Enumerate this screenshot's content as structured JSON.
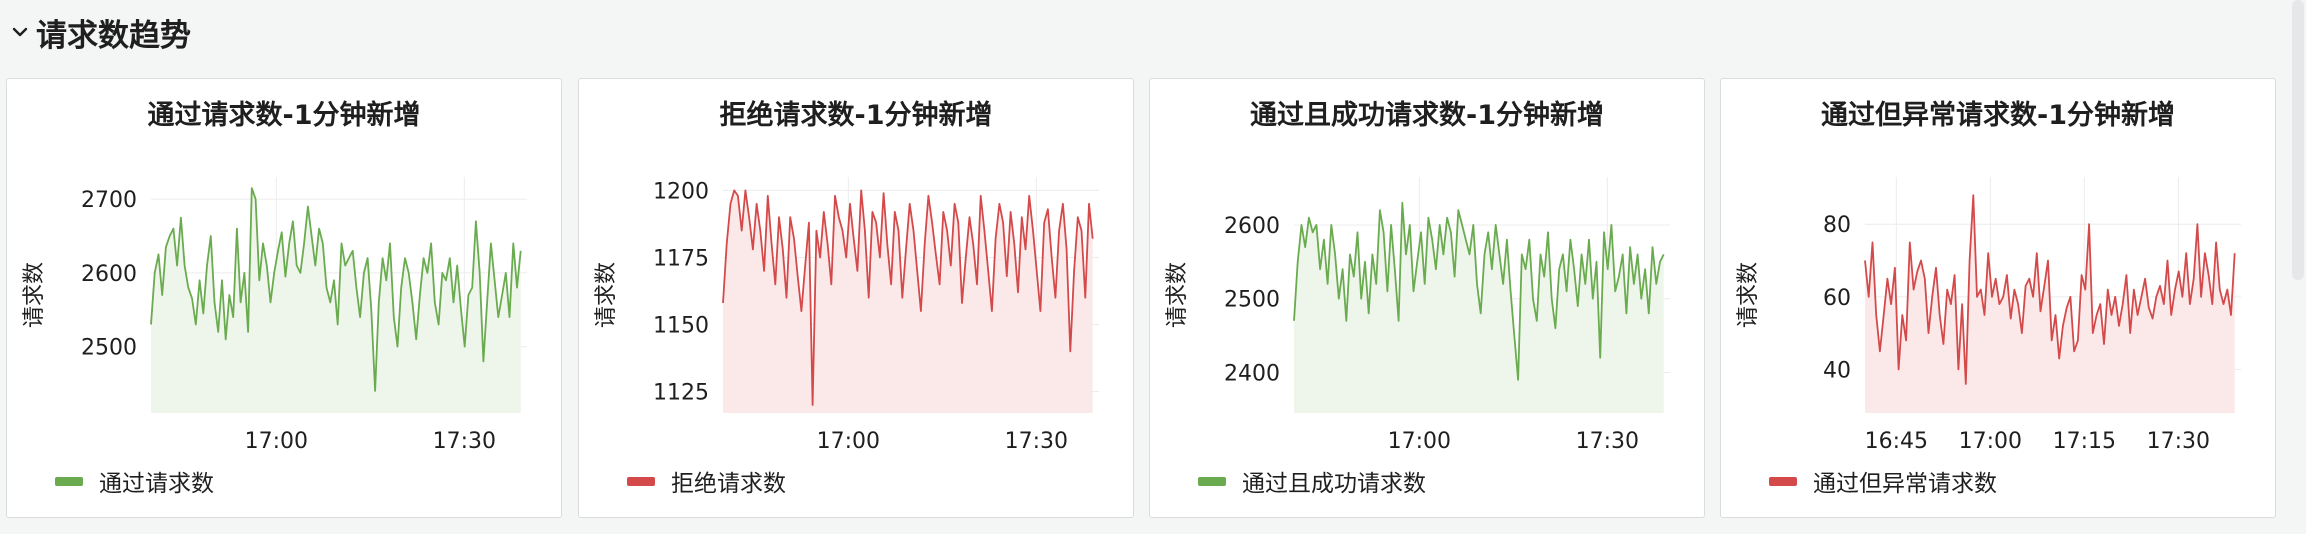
{
  "section": {
    "title": "请求数趋势"
  },
  "chart_data": [
    {
      "type": "area",
      "title": "通过请求数-1分钟新增",
      "ylabel": "请求数",
      "yticks": [
        2500,
        2600,
        2700
      ],
      "ylim": [
        2410,
        2730
      ],
      "xticks": [
        "17:00",
        "17:30"
      ],
      "xlim": [
        "16:40",
        "17:40"
      ],
      "color": "#6aab50",
      "fill": "#eef5ea",
      "series": [
        {
          "name": "通过请求数",
          "x_start": "16:40",
          "x_end": "17:39",
          "values": [
            2530,
            2600,
            2625,
            2570,
            2635,
            2650,
            2660,
            2610,
            2675,
            2610,
            2580,
            2565,
            2530,
            2590,
            2545,
            2610,
            2650,
            2560,
            2520,
            2590,
            2510,
            2570,
            2540,
            2660,
            2560,
            2600,
            2520,
            2715,
            2700,
            2590,
            2640,
            2610,
            2560,
            2600,
            2630,
            2655,
            2595,
            2640,
            2670,
            2610,
            2600,
            2640,
            2690,
            2650,
            2610,
            2660,
            2640,
            2580,
            2560,
            2590,
            2530,
            2640,
            2610,
            2620,
            2630,
            2580,
            2540,
            2600,
            2620,
            2550,
            2440,
            2560,
            2620,
            2590,
            2640,
            2540,
            2500,
            2580,
            2620,
            2600,
            2560,
            2510,
            2570,
            2620,
            2600,
            2640,
            2560,
            2530,
            2600,
            2590,
            2620,
            2560,
            2610,
            2550,
            2500,
            2570,
            2580,
            2670,
            2600,
            2480,
            2560,
            2640,
            2590,
            2540,
            2570,
            2600,
            2540,
            2640,
            2580,
            2630
          ]
        }
      ]
    },
    {
      "type": "area",
      "title": "拒绝请求数-1分钟新增",
      "ylabel": "请求数",
      "yticks": [
        1125,
        1150,
        1175,
        1200
      ],
      "ylim": [
        1117,
        1205
      ],
      "xticks": [
        "17:00",
        "17:30"
      ],
      "xlim": [
        "16:40",
        "17:40"
      ],
      "color": "#d44a4a",
      "fill": "#fbe9ea",
      "series": [
        {
          "name": "拒绝请求数",
          "x_start": "16:40",
          "x_end": "17:39",
          "values": [
            1158,
            1180,
            1195,
            1200,
            1198,
            1185,
            1200,
            1190,
            1178,
            1195,
            1185,
            1170,
            1198,
            1180,
            1165,
            1190,
            1178,
            1160,
            1190,
            1182,
            1168,
            1155,
            1172,
            1188,
            1120,
            1185,
            1175,
            1192,
            1180,
            1165,
            1198,
            1190,
            1185,
            1175,
            1195,
            1182,
            1170,
            1200,
            1185,
            1160,
            1192,
            1188,
            1175,
            1199,
            1180,
            1165,
            1192,
            1185,
            1160,
            1178,
            1195,
            1185,
            1170,
            1155,
            1180,
            1198,
            1188,
            1176,
            1165,
            1192,
            1185,
            1172,
            1195,
            1188,
            1158,
            1175,
            1190,
            1180,
            1165,
            1198,
            1185,
            1170,
            1155,
            1182,
            1195,
            1188,
            1168,
            1192,
            1180,
            1162,
            1190,
            1178,
            1198,
            1185,
            1170,
            1155,
            1188,
            1193,
            1175,
            1160,
            1185,
            1195,
            1178,
            1140,
            1170,
            1190,
            1185,
            1160,
            1195,
            1182
          ]
        }
      ]
    },
    {
      "type": "area",
      "title": "通过且成功请求数-1分钟新增",
      "ylabel": "请求数",
      "yticks": [
        2400,
        2500,
        2600
      ],
      "ylim": [
        2345,
        2665
      ],
      "xticks": [
        "17:00",
        "17:30"
      ],
      "xlim": [
        "16:40",
        "17:40"
      ],
      "color": "#6aab50",
      "fill": "#eef5ea",
      "series": [
        {
          "name": "通过且成功请求数",
          "x_start": "16:40",
          "x_end": "17:39",
          "values": [
            2470,
            2550,
            2600,
            2570,
            2610,
            2590,
            2600,
            2540,
            2580,
            2520,
            2600,
            2560,
            2500,
            2540,
            2470,
            2560,
            2530,
            2590,
            2500,
            2550,
            2480,
            2560,
            2520,
            2620,
            2590,
            2510,
            2600,
            2540,
            2470,
            2630,
            2560,
            2600,
            2510,
            2550,
            2590,
            2520,
            2610,
            2580,
            2540,
            2600,
            2560,
            2610,
            2590,
            2530,
            2620,
            2600,
            2580,
            2560,
            2600,
            2520,
            2480,
            2560,
            2590,
            2540,
            2600,
            2560,
            2520,
            2580,
            2510,
            2450,
            2390,
            2560,
            2540,
            2580,
            2500,
            2470,
            2560,
            2530,
            2590,
            2500,
            2460,
            2540,
            2560,
            2510,
            2580,
            2540,
            2490,
            2560,
            2520,
            2580,
            2500,
            2550,
            2420,
            2590,
            2540,
            2600,
            2510,
            2530,
            2560,
            2480,
            2570,
            2520,
            2560,
            2500,
            2540,
            2480,
            2570,
            2520,
            2550,
            2560
          ]
        }
      ]
    },
    {
      "type": "area",
      "title": "通过但异常请求数-1分钟新增",
      "ylabel": "请求数",
      "yticks": [
        40,
        60,
        80
      ],
      "ylim": [
        28,
        93
      ],
      "xticks": [
        "16:45",
        "17:00",
        "17:15",
        "17:30"
      ],
      "xlim": [
        "16:40",
        "17:40"
      ],
      "color": "#d44a4a",
      "fill": "#fbe9ea",
      "series": [
        {
          "name": "通过但异常请求数",
          "x_start": "16:40",
          "x_end": "17:39",
          "values": [
            70,
            60,
            75,
            55,
            45,
            55,
            65,
            58,
            68,
            40,
            55,
            48,
            75,
            62,
            67,
            70,
            65,
            50,
            60,
            68,
            55,
            47,
            62,
            58,
            66,
            40,
            58,
            36,
            70,
            88,
            60,
            62,
            55,
            72,
            60,
            65,
            58,
            60,
            66,
            54,
            62,
            58,
            50,
            63,
            65,
            60,
            72,
            56,
            63,
            70,
            48,
            55,
            43,
            52,
            57,
            60,
            45,
            48,
            66,
            62,
            80,
            50,
            55,
            58,
            47,
            62,
            55,
            60,
            52,
            58,
            66,
            50,
            62,
            55,
            60,
            65,
            57,
            54,
            60,
            63,
            58,
            70,
            55,
            62,
            67,
            60,
            72,
            58,
            65,
            80,
            60,
            72,
            66,
            58,
            75,
            62,
            58,
            62,
            55,
            72
          ]
        }
      ]
    }
  ]
}
